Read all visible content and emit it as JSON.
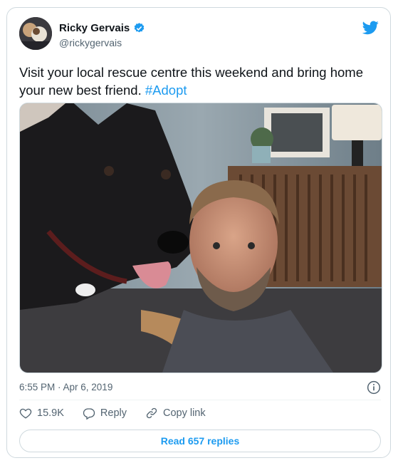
{
  "tweet": {
    "author_name": "Ricky Gervais",
    "author_handle": "@rickygervais",
    "text": "Visit your local rescue centre this weekend and bring home your new best friend. ",
    "hashtag": "#Adopt",
    "timestamp": "6:55 PM · Apr 6, 2019",
    "likes": "15.9K",
    "reply_label": "Reply",
    "copy_link_label": "Copy link",
    "read_replies_label": "Read 657 replies"
  },
  "icons": {
    "brand": "twitter-bird-icon",
    "verified": "verified-badge-icon",
    "info": "info-icon",
    "like": "heart-icon",
    "reply": "reply-icon",
    "link": "link-icon"
  },
  "colors": {
    "accent": "#1d9bf0",
    "text": "#0f1419",
    "secondary": "#536471",
    "border": "#cfd9de"
  }
}
